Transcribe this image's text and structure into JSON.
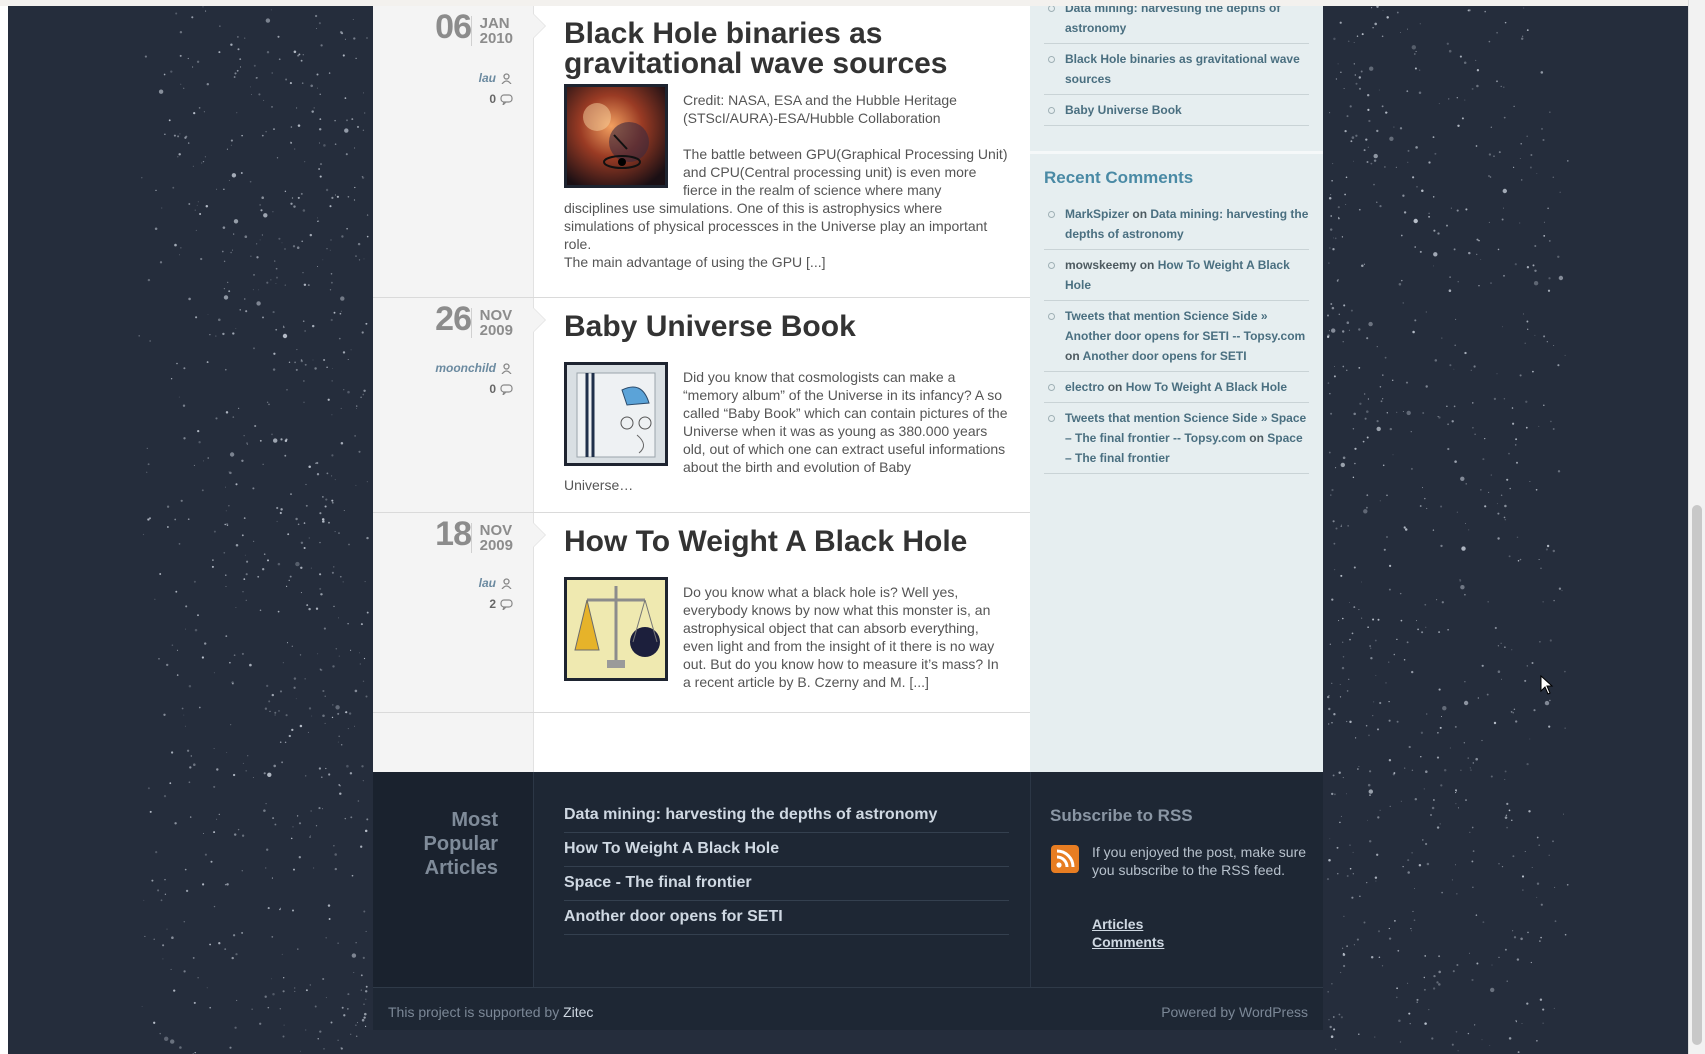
{
  "posts": [
    {
      "day": "06",
      "month": "JAN",
      "year": "2010",
      "author": "lau",
      "comments": "0",
      "title": "Black Hole binaries as gravitational wave sources",
      "text_indented": "Credit: NASA, ESA and the Hubble Heritage (STScI/AURA)-ESA/Hubble Collaboration",
      "text_indented2": "The battle between GPU(Graphical Processing Unit) and CPU(Central processing unit) is even more fierce in the realm of science where many",
      "text_rest": "disciplines use simulations. One of this is astrophysics where simulations of physical processces in the Universe play an important role.",
      "text_more": "The main advantage of using the GPU [...]"
    },
    {
      "day": "26",
      "month": "NOV",
      "year": "2009",
      "author": "moonchild",
      "comments": "0",
      "title": "Baby Universe Book",
      "text_indented": "Did you know that cosmologists can make a “memory album” of the Universe in its infancy? A so called “Baby Book” which can contain pictures of the Universe when it was as young as 380.000 years old, out of which one can extract useful informations about the birth and evolution of Baby",
      "text_rest": "Universe…"
    },
    {
      "day": "18",
      "month": "NOV",
      "year": "2009",
      "author": "lau",
      "comments": "2",
      "title": "How To Weight A Black Hole",
      "text_indented": "Do you know what a black hole is? Well yes, everybody knows by now what this monster is, an astrophysical object that can absorb everything, even light and from the insight of it there is no way out. But do you know how to measure it’s mass? In a recent article by B. Czerny and M. [...]"
    }
  ],
  "sidebar": {
    "recent_posts": [
      "Data mining: harvesting the depths of astronomy",
      "Black Hole binaries as gravitational wave sources",
      "Baby Universe Book"
    ],
    "recent_comments_title": "Recent Comments",
    "recent_comments": [
      {
        "author": "MarkSpizer",
        "on": "on",
        "post": "Data mining: harvesting the depths of astronomy"
      },
      {
        "author": "mowskeemy",
        "on": "on",
        "post": "How To Weight A Black Hole"
      },
      {
        "author": "Tweets that mention Science Side » Another door opens for SETI -- Topsy.com",
        "on": "on",
        "post": "Another door opens for SETI"
      },
      {
        "author": "electro",
        "on": "on",
        "post": "How To Weight A Black Hole"
      },
      {
        "author": "Tweets that mention Science Side » Space – The final frontier -- Topsy.com",
        "on": "on",
        "post": "Space – The final frontier"
      }
    ]
  },
  "footer": {
    "most_popular_title": "Most Popular Articles",
    "most_popular": [
      "Data mining: harvesting the depths of astronomy",
      "How To Weight A Black Hole",
      "Space - The final frontier",
      "Another door opens for SETI"
    ],
    "rss_title": "Subscribe to RSS",
    "rss_text": "If you enjoyed the post, make sure you subscribe to the RSS feed.",
    "rss_articles": "Articles",
    "rss_comments": "Comments",
    "supported_prefix": "This project is supported by",
    "supported_name": "Zitec",
    "powered": "Powered by WordPress"
  },
  "colors": {
    "background": "#252d3c",
    "footer": "#1e2734",
    "sidebar": "#e6eef0",
    "link": "#4a6f80",
    "rss": "#e77d22"
  }
}
